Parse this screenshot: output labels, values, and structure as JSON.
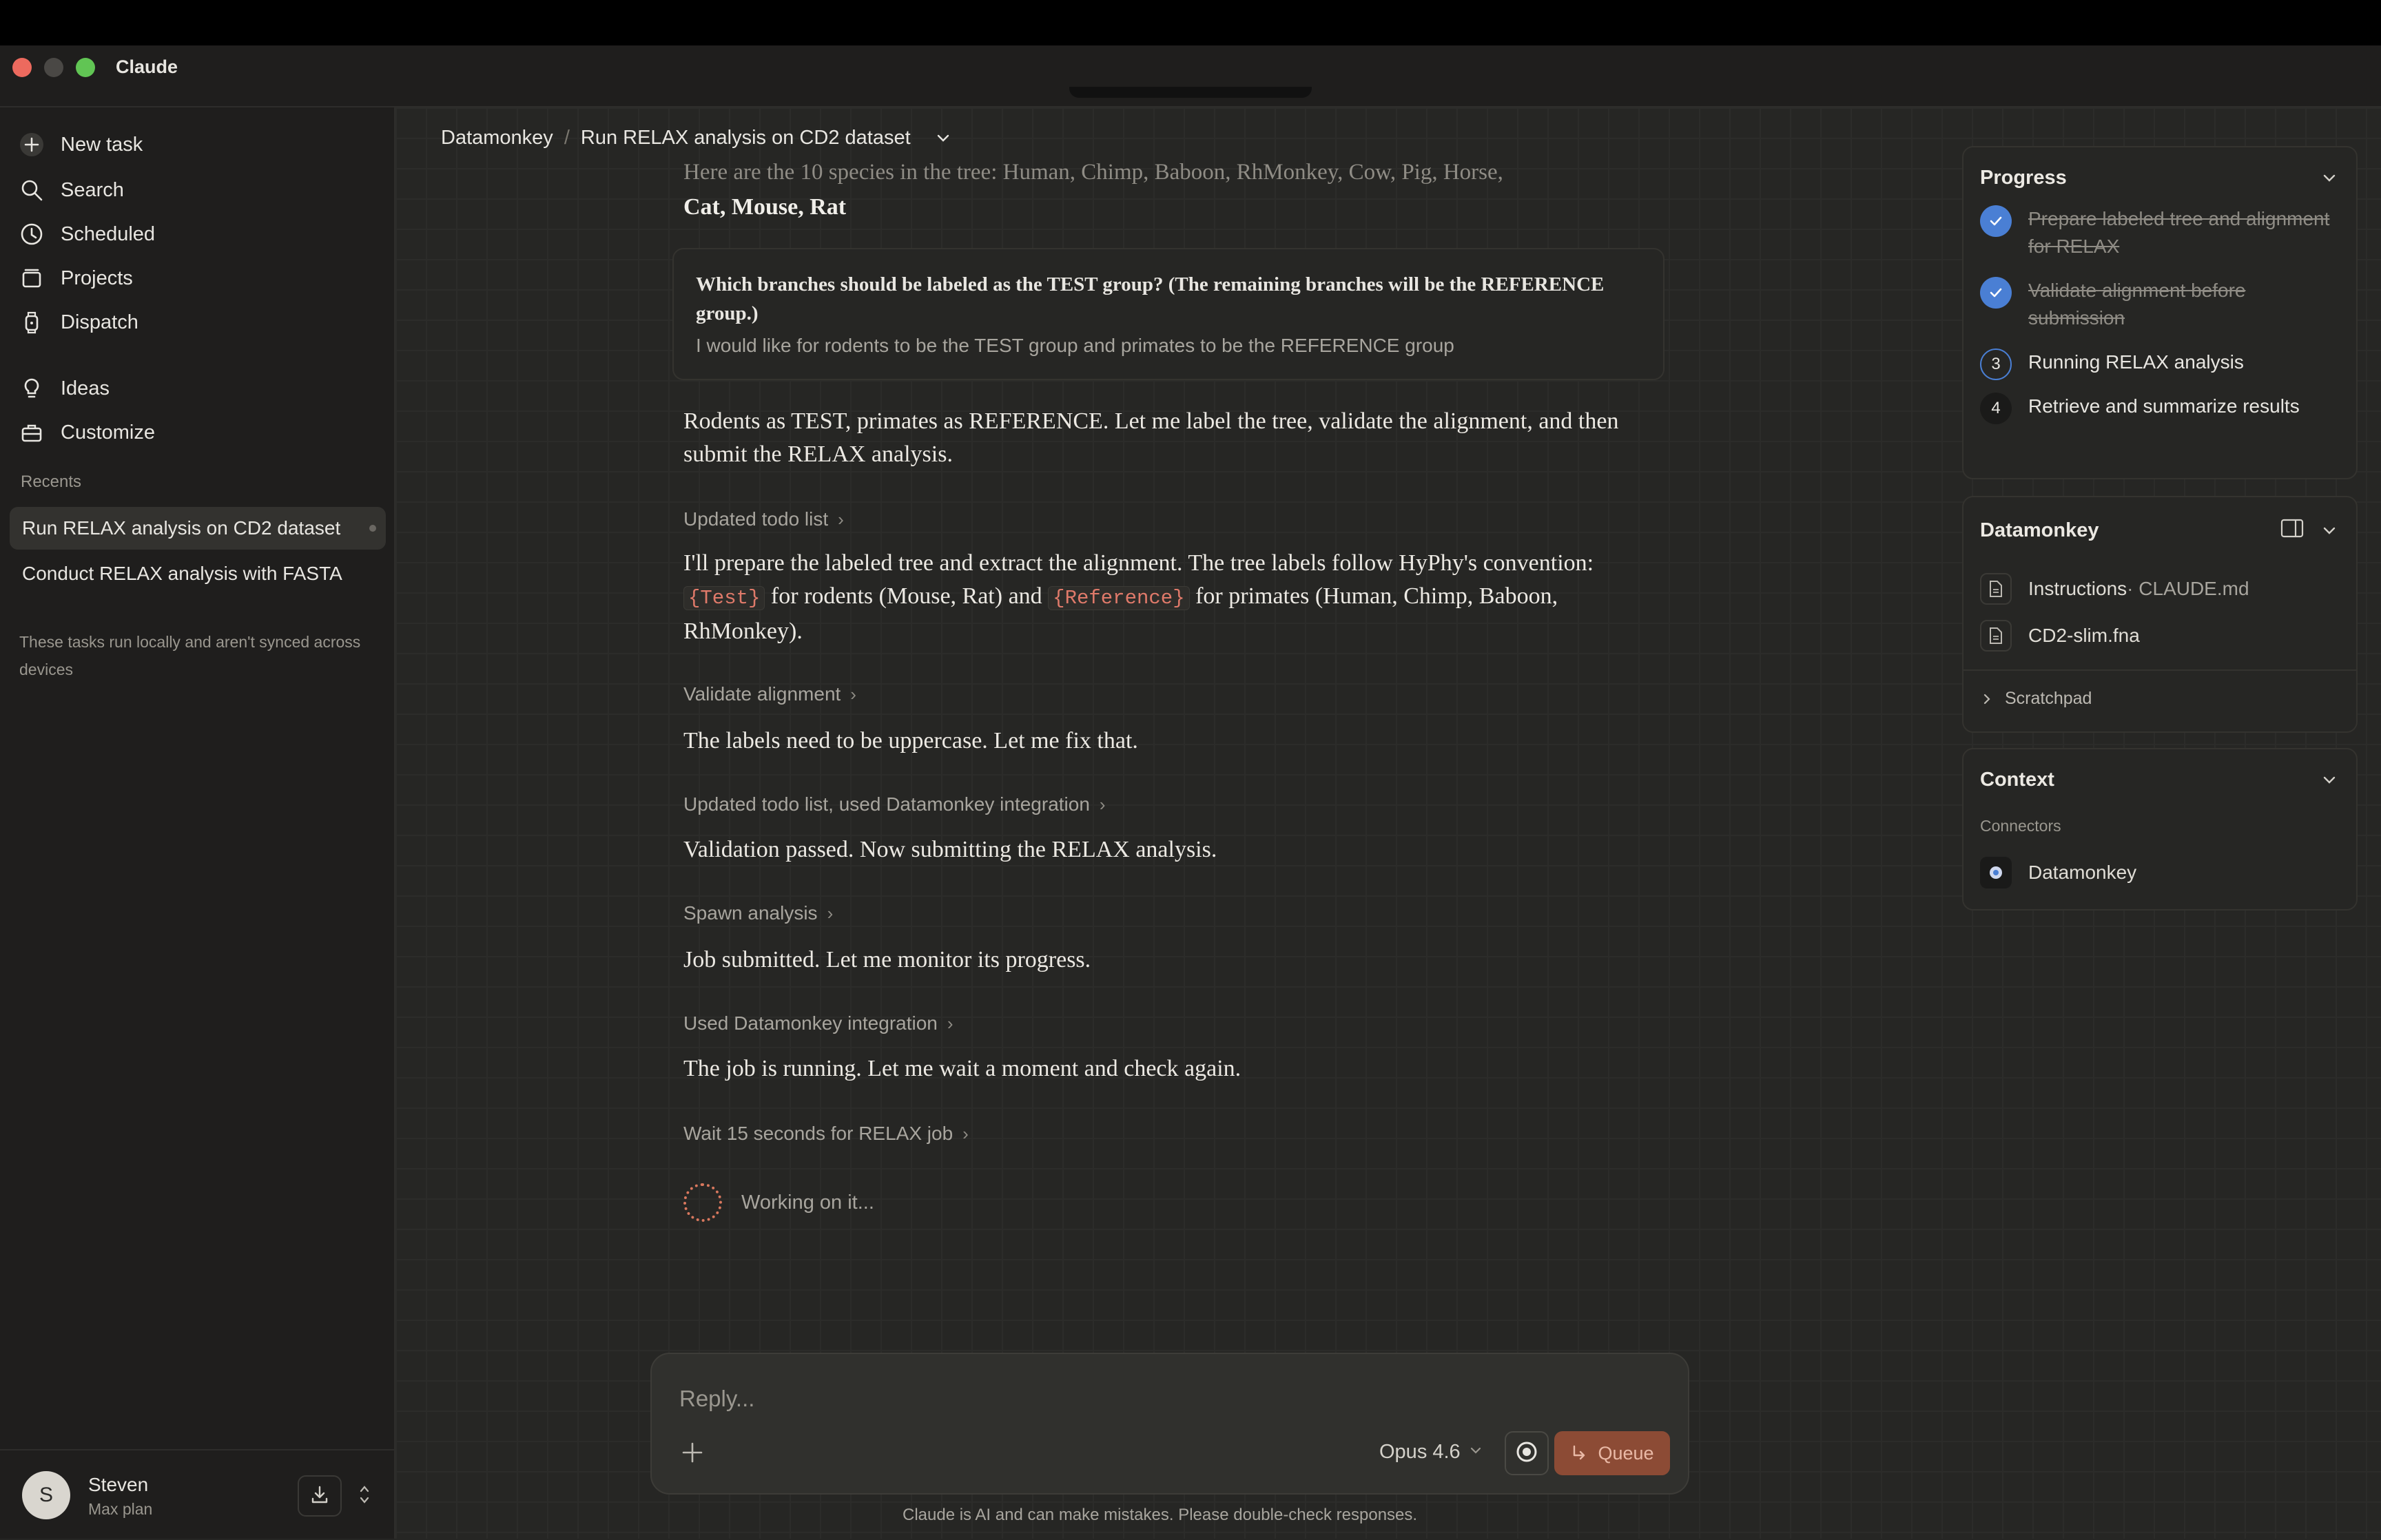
{
  "app": {
    "title": "Claude"
  },
  "sidebar": {
    "nav": [
      {
        "label": "New task",
        "icon": "plus-circle-icon"
      },
      {
        "label": "Search",
        "icon": "search-icon"
      },
      {
        "label": "Scheduled",
        "icon": "clock-icon"
      },
      {
        "label": "Projects",
        "icon": "folder-icon"
      },
      {
        "label": "Dispatch",
        "icon": "watch-icon"
      },
      {
        "label": "Ideas",
        "icon": "lightbulb-icon"
      },
      {
        "label": "Customize",
        "icon": "briefcase-icon"
      }
    ],
    "recents_header": "Recents",
    "recents": [
      {
        "label": "Run RELAX analysis on CD2 dataset"
      },
      {
        "label": "Conduct RELAX analysis with FASTA"
      }
    ],
    "sync_note": "These tasks run locally and aren't synced across devices",
    "user": {
      "initial": "S",
      "name": "Steven",
      "plan": "Max plan"
    }
  },
  "breadcrumb": {
    "root": "Datamonkey",
    "sep": "/",
    "current": "Run RELAX analysis on CD2 dataset"
  },
  "conversation": {
    "faded_line": "Here are the 10 species in the tree: Human, Chimp, Baboon, RhMonkey, Cow, Pig, Horse,",
    "species_bold": "Cat, Mouse, Rat",
    "qa": {
      "question": "Which branches should be labeled as the TEST group? (The remaining branches will be the REFERENCE group.)",
      "answer": "I would like for rodents to be the TEST group and primates to be the REFERENCE group"
    },
    "msg1": "Rodents as TEST, primates as REFERENCE. Let me label the tree, validate the alignment, and then submit the RELAX analysis.",
    "tool1": "Updated todo list",
    "msg2": {
      "part1": "I'll prepare the labeled tree and extract the alignment. The tree labels follow HyPhy's convention: ",
      "code1": "{Test}",
      "part2": " for rodents (Mouse, Rat) and ",
      "code2": "{Reference}",
      "part3": " for primates (Human, Chimp, Baboon, RhMonkey)."
    },
    "tool2": "Validate alignment",
    "msg3": "The labels need to be uppercase. Let me fix that.",
    "tool3": "Updated todo list, used Datamonkey integration",
    "msg4": "Validation passed. Now submitting the RELAX analysis.",
    "tool4": "Spawn analysis",
    "msg5": "Job submitted. Let me monitor its progress.",
    "tool5": "Used Datamonkey integration",
    "msg6": "The job is running. Let me wait a moment and check again.",
    "tool6": "Wait 15 seconds for RELAX job",
    "working": "Working on it..."
  },
  "composer": {
    "placeholder": "Reply...",
    "model": "Opus 4.6",
    "queue_label": "Queue",
    "disclaimer": "Claude is AI and can make mistakes. Please double-check responses."
  },
  "progress": {
    "title": "Progress",
    "steps": [
      {
        "num": "",
        "label": "Prepare labeled tree and alignment for RELAX",
        "status": "done"
      },
      {
        "num": "",
        "label": "Validate alignment before submission",
        "status": "done"
      },
      {
        "num": "3",
        "label": "Running RELAX analysis",
        "status": "active"
      },
      {
        "num": "4",
        "label": "Retrieve and summarize results",
        "status": "pending"
      }
    ]
  },
  "workspace": {
    "title": "Datamonkey",
    "files": [
      {
        "name": "Instructions",
        "sub": " · CLAUDE.md"
      },
      {
        "name": "CD2-slim.fna",
        "sub": ""
      }
    ],
    "scratchpad": "Scratchpad"
  },
  "context": {
    "title": "Context",
    "connectors_label": "Connectors",
    "connector": "Datamonkey"
  },
  "colors": {
    "accent": "#8c4b35",
    "check": "#4a7fd4",
    "background": "#262624",
    "sidebar": "#1f1e1d"
  }
}
